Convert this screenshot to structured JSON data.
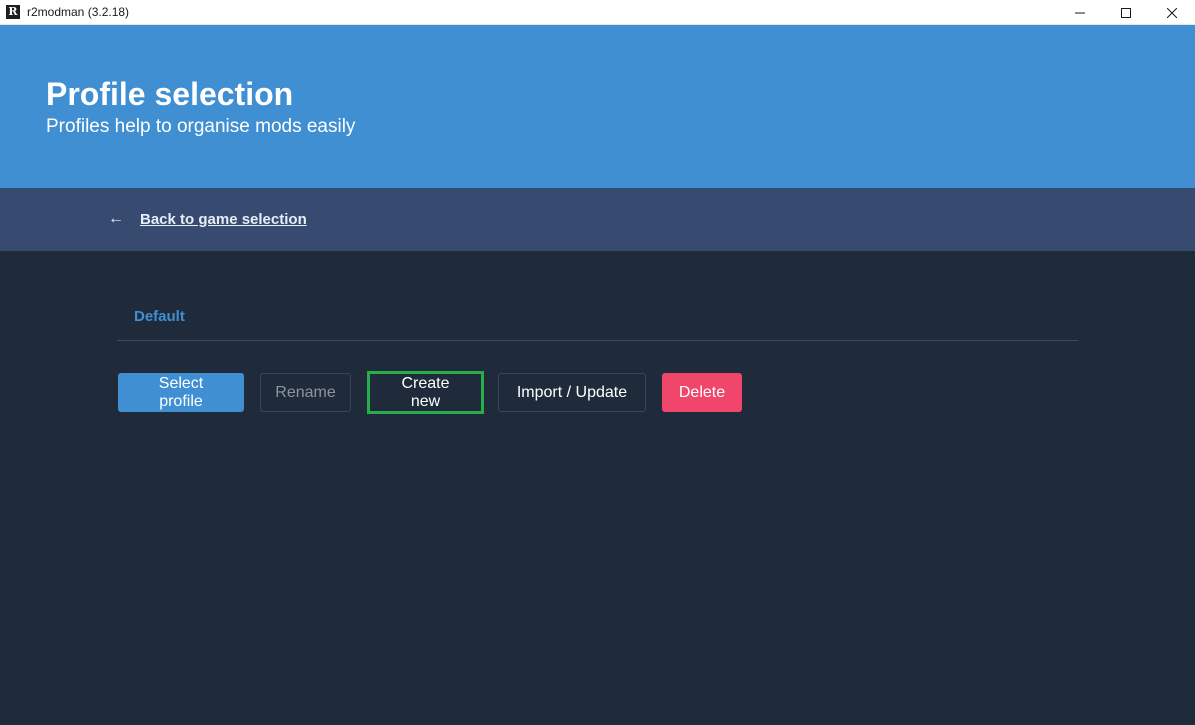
{
  "window": {
    "title": "r2modman (3.2.18)",
    "icon_letter": "R"
  },
  "hero": {
    "title": "Profile selection",
    "subtitle": "Profiles help to organise mods easily"
  },
  "nav": {
    "back_arrow": "←",
    "back_label": "Back to game selection"
  },
  "profiles": [
    {
      "name": "Default",
      "selected": true
    }
  ],
  "actions": {
    "select_label": "Select profile",
    "rename_label": "Rename",
    "create_label": "Create new",
    "import_label": "Import / Update",
    "delete_label": "Delete"
  },
  "colors": {
    "accent": "#3f8fd2",
    "danger": "#f0466b",
    "highlight": "#27ad4a",
    "background": "#1f2b3a",
    "backbar": "#374a6f"
  }
}
